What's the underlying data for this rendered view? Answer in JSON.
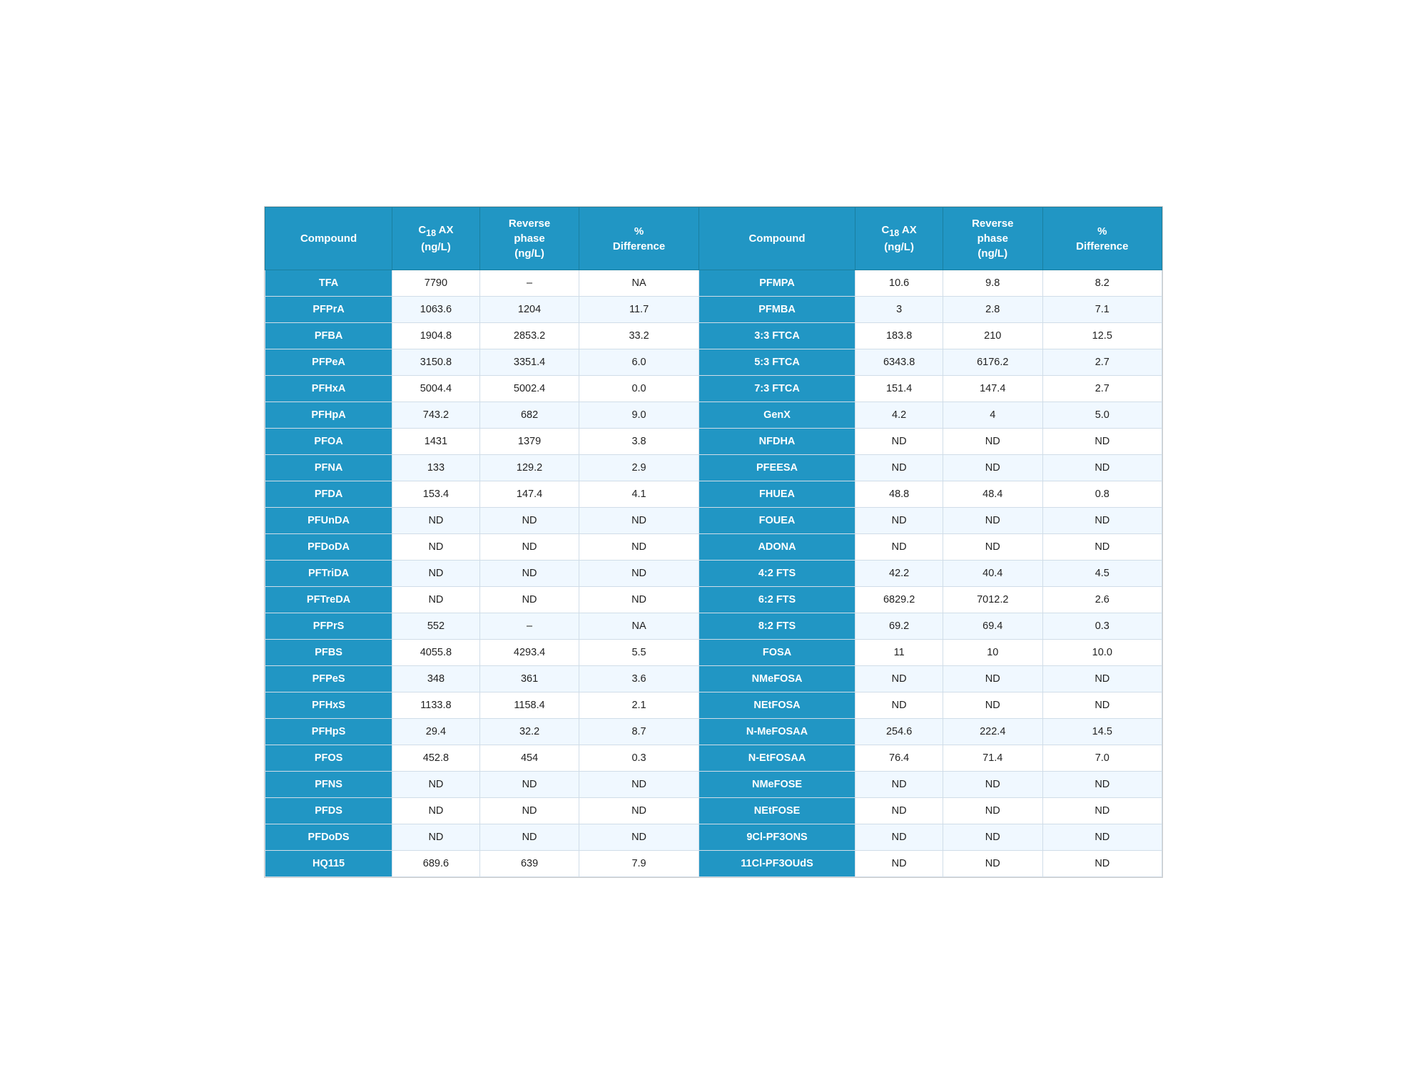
{
  "headers": {
    "left": [
      "Compound",
      "C18 AX (ng/L)",
      "Reverse phase (ng/L)",
      "% Difference"
    ],
    "right": [
      "Compound",
      "C18 AX (ng/L)",
      "Reverse phase (ng/L)",
      "% Difference"
    ]
  },
  "rows": [
    {
      "l_compound": "TFA",
      "l_c18": "7790",
      "l_rp": "–",
      "l_diff": "NA",
      "r_compound": "PFMPA",
      "r_c18": "10.6",
      "r_rp": "9.8",
      "r_diff": "8.2"
    },
    {
      "l_compound": "PFPrA",
      "l_c18": "1063.6",
      "l_rp": "1204",
      "l_diff": "11.7",
      "r_compound": "PFMBA",
      "r_c18": "3",
      "r_rp": "2.8",
      "r_diff": "7.1"
    },
    {
      "l_compound": "PFBA",
      "l_c18": "1904.8",
      "l_rp": "2853.2",
      "l_diff": "33.2",
      "r_compound": "3:3 FTCA",
      "r_c18": "183.8",
      "r_rp": "210",
      "r_diff": "12.5"
    },
    {
      "l_compound": "PFPeA",
      "l_c18": "3150.8",
      "l_rp": "3351.4",
      "l_diff": "6.0",
      "r_compound": "5:3 FTCA",
      "r_c18": "6343.8",
      "r_rp": "6176.2",
      "r_diff": "2.7"
    },
    {
      "l_compound": "PFHxA",
      "l_c18": "5004.4",
      "l_rp": "5002.4",
      "l_diff": "0.0",
      "r_compound": "7:3 FTCA",
      "r_c18": "151.4",
      "r_rp": "147.4",
      "r_diff": "2.7"
    },
    {
      "l_compound": "PFHpA",
      "l_c18": "743.2",
      "l_rp": "682",
      "l_diff": "9.0",
      "r_compound": "GenX",
      "r_c18": "4.2",
      "r_rp": "4",
      "r_diff": "5.0"
    },
    {
      "l_compound": "PFOA",
      "l_c18": "1431",
      "l_rp": "1379",
      "l_diff": "3.8",
      "r_compound": "NFDHA",
      "r_c18": "ND",
      "r_rp": "ND",
      "r_diff": "ND"
    },
    {
      "l_compound": "PFNA",
      "l_c18": "133",
      "l_rp": "129.2",
      "l_diff": "2.9",
      "r_compound": "PFEESA",
      "r_c18": "ND",
      "r_rp": "ND",
      "r_diff": "ND"
    },
    {
      "l_compound": "PFDA",
      "l_c18": "153.4",
      "l_rp": "147.4",
      "l_diff": "4.1",
      "r_compound": "FHUEA",
      "r_c18": "48.8",
      "r_rp": "48.4",
      "r_diff": "0.8"
    },
    {
      "l_compound": "PFUnDA",
      "l_c18": "ND",
      "l_rp": "ND",
      "l_diff": "ND",
      "r_compound": "FOUEA",
      "r_c18": "ND",
      "r_rp": "ND",
      "r_diff": "ND"
    },
    {
      "l_compound": "PFDoDA",
      "l_c18": "ND",
      "l_rp": "ND",
      "l_diff": "ND",
      "r_compound": "ADONA",
      "r_c18": "ND",
      "r_rp": "ND",
      "r_diff": "ND"
    },
    {
      "l_compound": "PFTriDA",
      "l_c18": "ND",
      "l_rp": "ND",
      "l_diff": "ND",
      "r_compound": "4:2 FTS",
      "r_c18": "42.2",
      "r_rp": "40.4",
      "r_diff": "4.5"
    },
    {
      "l_compound": "PFTreDA",
      "l_c18": "ND",
      "l_rp": "ND",
      "l_diff": "ND",
      "r_compound": "6:2 FTS",
      "r_c18": "6829.2",
      "r_rp": "7012.2",
      "r_diff": "2.6"
    },
    {
      "l_compound": "PFPrS",
      "l_c18": "552",
      "l_rp": "–",
      "l_diff": "NA",
      "r_compound": "8:2 FTS",
      "r_c18": "69.2",
      "r_rp": "69.4",
      "r_diff": "0.3"
    },
    {
      "l_compound": "PFBS",
      "l_c18": "4055.8",
      "l_rp": "4293.4",
      "l_diff": "5.5",
      "r_compound": "FOSA",
      "r_c18": "11",
      "r_rp": "10",
      "r_diff": "10.0"
    },
    {
      "l_compound": "PFPeS",
      "l_c18": "348",
      "l_rp": "361",
      "l_diff": "3.6",
      "r_compound": "NMeFOSA",
      "r_c18": "ND",
      "r_rp": "ND",
      "r_diff": "ND"
    },
    {
      "l_compound": "PFHxS",
      "l_c18": "1133.8",
      "l_rp": "1158.4",
      "l_diff": "2.1",
      "r_compound": "NEtFOSA",
      "r_c18": "ND",
      "r_rp": "ND",
      "r_diff": "ND"
    },
    {
      "l_compound": "PFHpS",
      "l_c18": "29.4",
      "l_rp": "32.2",
      "l_diff": "8.7",
      "r_compound": "N-MeFOSAA",
      "r_c18": "254.6",
      "r_rp": "222.4",
      "r_diff": "14.5"
    },
    {
      "l_compound": "PFOS",
      "l_c18": "452.8",
      "l_rp": "454",
      "l_diff": "0.3",
      "r_compound": "N-EtFOSAA",
      "r_c18": "76.4",
      "r_rp": "71.4",
      "r_diff": "7.0"
    },
    {
      "l_compound": "PFNS",
      "l_c18": "ND",
      "l_rp": "ND",
      "l_diff": "ND",
      "r_compound": "NMeFOSE",
      "r_c18": "ND",
      "r_rp": "ND",
      "r_diff": "ND"
    },
    {
      "l_compound": "PFDS",
      "l_c18": "ND",
      "l_rp": "ND",
      "l_diff": "ND",
      "r_compound": "NEtFOSE",
      "r_c18": "ND",
      "r_rp": "ND",
      "r_diff": "ND"
    },
    {
      "l_compound": "PFDoDS",
      "l_c18": "ND",
      "l_rp": "ND",
      "l_diff": "ND",
      "r_compound": "9Cl-PF3ONS",
      "r_c18": "ND",
      "r_rp": "ND",
      "r_diff": "ND"
    },
    {
      "l_compound": "HQ115",
      "l_c18": "689.6",
      "l_rp": "639",
      "l_diff": "7.9",
      "r_compound": "11Cl-PF3OUdS",
      "r_c18": "ND",
      "r_rp": "ND",
      "r_diff": "ND"
    }
  ]
}
